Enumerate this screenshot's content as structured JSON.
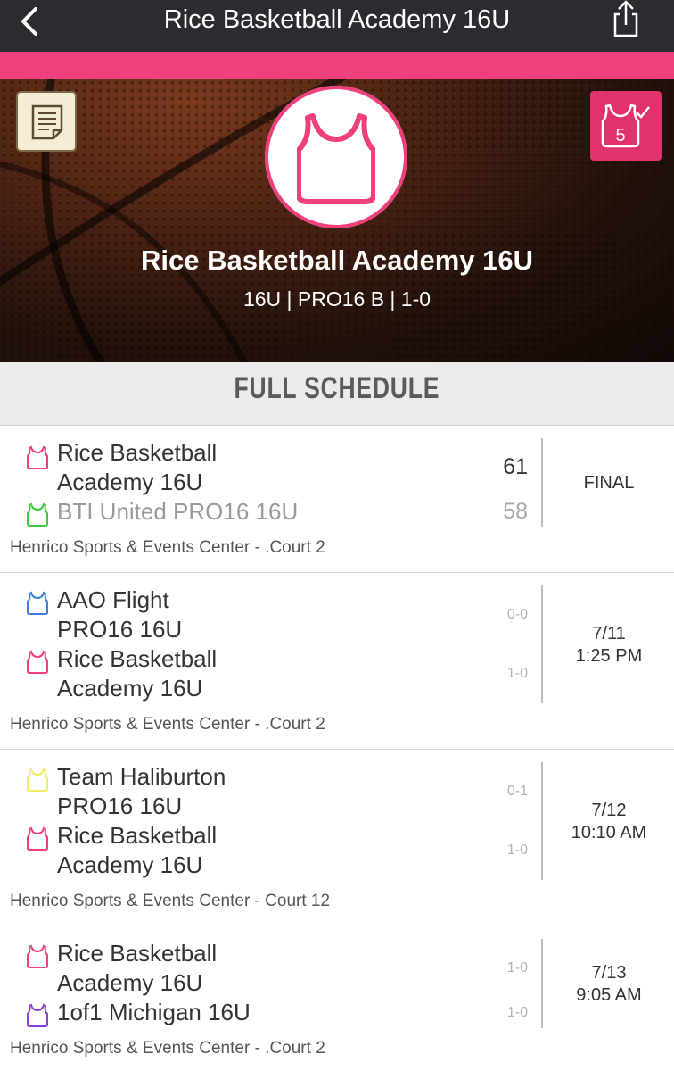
{
  "nav": {
    "title": "Rice Basketball Academy 16U"
  },
  "team": {
    "name": "Rice Basketball Academy 16U",
    "meta": "16U | PRO16 B | 1-0"
  },
  "roster_badge": "5",
  "section_title": "FULL SCHEDULE",
  "colors": {
    "pink": "#ef3f7d",
    "green": "#3ec93e",
    "blue": "#3a7fd8",
    "yellow": "#f2ee6a",
    "purple": "#8e3fd6"
  },
  "games": [
    {
      "team1": {
        "line1": "Rice Basketball",
        "line2": "Academy 16U",
        "jersey_color": "pink",
        "score": "61"
      },
      "team2": {
        "line1": "BTI United PRO16 16U",
        "jersey_color": "green",
        "score": "58"
      },
      "status": "FINAL",
      "venue": "Henrico Sports & Events Center - .Court 2"
    },
    {
      "team1": {
        "line1": "AAO Flight",
        "line2": "PRO16 16U",
        "jersey_color": "blue",
        "record": "0-0"
      },
      "team2": {
        "line1": "Rice Basketball",
        "line2": "Academy 16U",
        "jersey_color": "pink",
        "record": "1-0"
      },
      "date": "7/11",
      "time": "1:25 PM",
      "venue": "Henrico Sports & Events Center - .Court 2"
    },
    {
      "team1": {
        "line1": "Team Haliburton",
        "line2": "PRO16 16U",
        "jersey_color": "yellow",
        "record": "0-1"
      },
      "team2": {
        "line1": "Rice Basketball",
        "line2": "Academy 16U",
        "jersey_color": "pink",
        "record": "1-0"
      },
      "date": "7/12",
      "time": "10:10 AM",
      "venue": "Henrico Sports & Events Center - Court 12"
    },
    {
      "team1": {
        "line1": "Rice Basketball",
        "line2": "Academy 16U",
        "jersey_color": "pink",
        "record": "1-0"
      },
      "team2": {
        "line1": "1of1 Michigan 16U",
        "jersey_color": "purple",
        "record": "1-0"
      },
      "date": "7/13",
      "time": "9:05 AM",
      "venue": "Henrico Sports & Events Center - .Court 2"
    }
  ]
}
